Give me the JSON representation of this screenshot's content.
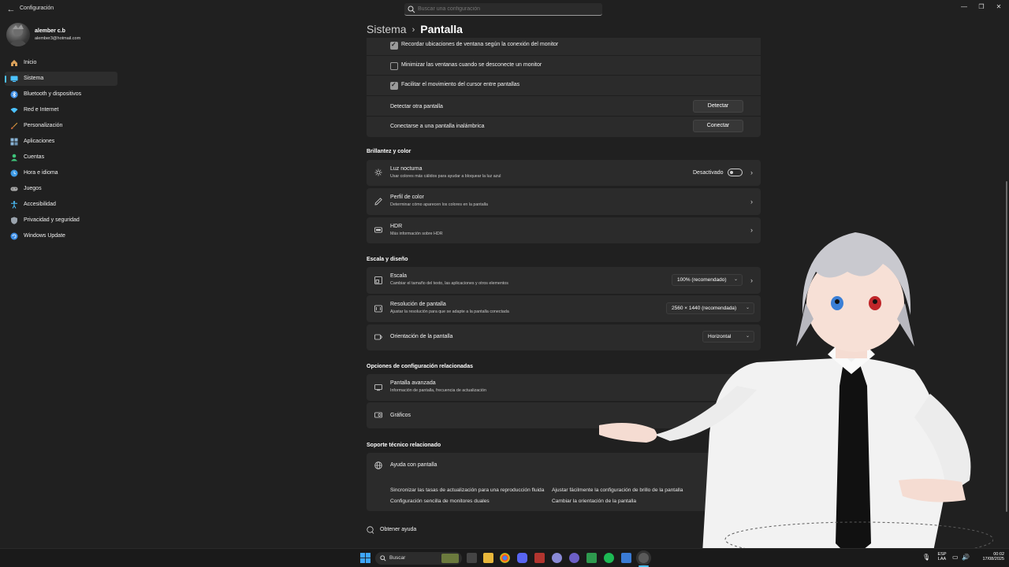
{
  "window": {
    "title": "Configuración",
    "search_placeholder": "Buscar una configuración",
    "controls": [
      "—",
      "❐",
      "✕"
    ]
  },
  "profile": {
    "name": "alember c.b",
    "email": "alember3@hotmail.com"
  },
  "sidebar": {
    "items": [
      {
        "label": "Inicio",
        "icon": "home-icon",
        "color": "#d9a05a"
      },
      {
        "label": "Sistema",
        "icon": "monitor-icon",
        "color": "#4cc2ff"
      },
      {
        "label": "Bluetooth y dispositivos",
        "icon": "bluetooth-icon",
        "color": "#3d8ee6"
      },
      {
        "label": "Red e Internet",
        "icon": "wifi-icon",
        "color": "#4cc2ff"
      },
      {
        "label": "Personalización",
        "icon": "brush-icon",
        "color": "#e0a040"
      },
      {
        "label": "Aplicaciones",
        "icon": "apps-icon",
        "color": "#8ab4d6"
      },
      {
        "label": "Cuentas",
        "icon": "person-icon",
        "color": "#3ec47a"
      },
      {
        "label": "Hora e idioma",
        "icon": "globe-clock-icon",
        "color": "#3d9be6"
      },
      {
        "label": "Juegos",
        "icon": "gamepad-icon",
        "color": "#aaaaaa"
      },
      {
        "label": "Accesibilidad",
        "icon": "accessibility-icon",
        "color": "#4cc2ff"
      },
      {
        "label": "Privacidad y seguridad",
        "icon": "shield-icon",
        "color": "#9aa3ad"
      },
      {
        "label": "Windows Update",
        "icon": "update-icon",
        "color": "#3d8ee6"
      }
    ],
    "active_index": 1
  },
  "breadcrumb": {
    "parent": "Sistema",
    "separator": "›",
    "current": "Pantalla"
  },
  "multi_monitor": {
    "remember_label": "Recordar ubicaciones de ventana según la conexión del monitor",
    "remember_checked": true,
    "minimize_label": "Minimizar las ventanas cuando se desconecte un monitor",
    "minimize_checked": false,
    "cursor_label": "Facilitar el movimiento del cursor entre pantallas",
    "cursor_checked": true,
    "detect_label": "Detectar otra pantalla",
    "detect_button": "Detectar",
    "connect_label": "Conectarse a una pantalla inalámbrica",
    "connect_button": "Conectar"
  },
  "brightness": {
    "heading": "Brillantez y color",
    "night_light": {
      "title": "Luz nocturna",
      "desc": "Usar colores más cálidos para ayudar a bloquear la luz azul",
      "state": "Desactivado"
    },
    "color_profile": {
      "title": "Perfil de color",
      "desc": "Determinar cómo aparecen los colores en la pantalla"
    },
    "hdr": {
      "title": "HDR",
      "desc": "Más información sobre HDR"
    }
  },
  "scale_layout": {
    "heading": "Escala y diseño",
    "scale": {
      "title": "Escala",
      "desc": "Cambiar el tamaño del texto, las aplicaciones y otros elementos",
      "value": "100% (recomendado)"
    },
    "resolution": {
      "title": "Resolución de pantalla",
      "desc": "Ajustar la resolución para que se adapte a la pantalla conectada",
      "value": "2560 × 1440 (recomendada)"
    },
    "orientation": {
      "title": "Orientación de la pantalla",
      "value": "Horizontal"
    }
  },
  "related": {
    "heading": "Opciones de configuración relacionadas",
    "advanced": {
      "title": "Pantalla avanzada",
      "desc": "Información de pantalla, frecuencia de actualización"
    },
    "graphics": {
      "title": "Gráficos"
    }
  },
  "support": {
    "heading": "Soporte técnico relacionado",
    "help_title": "Ayuda con pantalla",
    "links": [
      "Sincronizar las tasas de actualización para una reproducción fluida",
      "Ajustar fácilmente la configuración de brillo de la pantalla",
      "Configuración sencilla de monitores duales",
      "Cambiar la orientación de la pantalla"
    ]
  },
  "get_help": "Obtener ayuda",
  "taskbar": {
    "search_label": "Buscar",
    "lang_top": "ESP",
    "lang_bottom": "LAA",
    "time": "00:02",
    "date": "17/08/2025"
  }
}
